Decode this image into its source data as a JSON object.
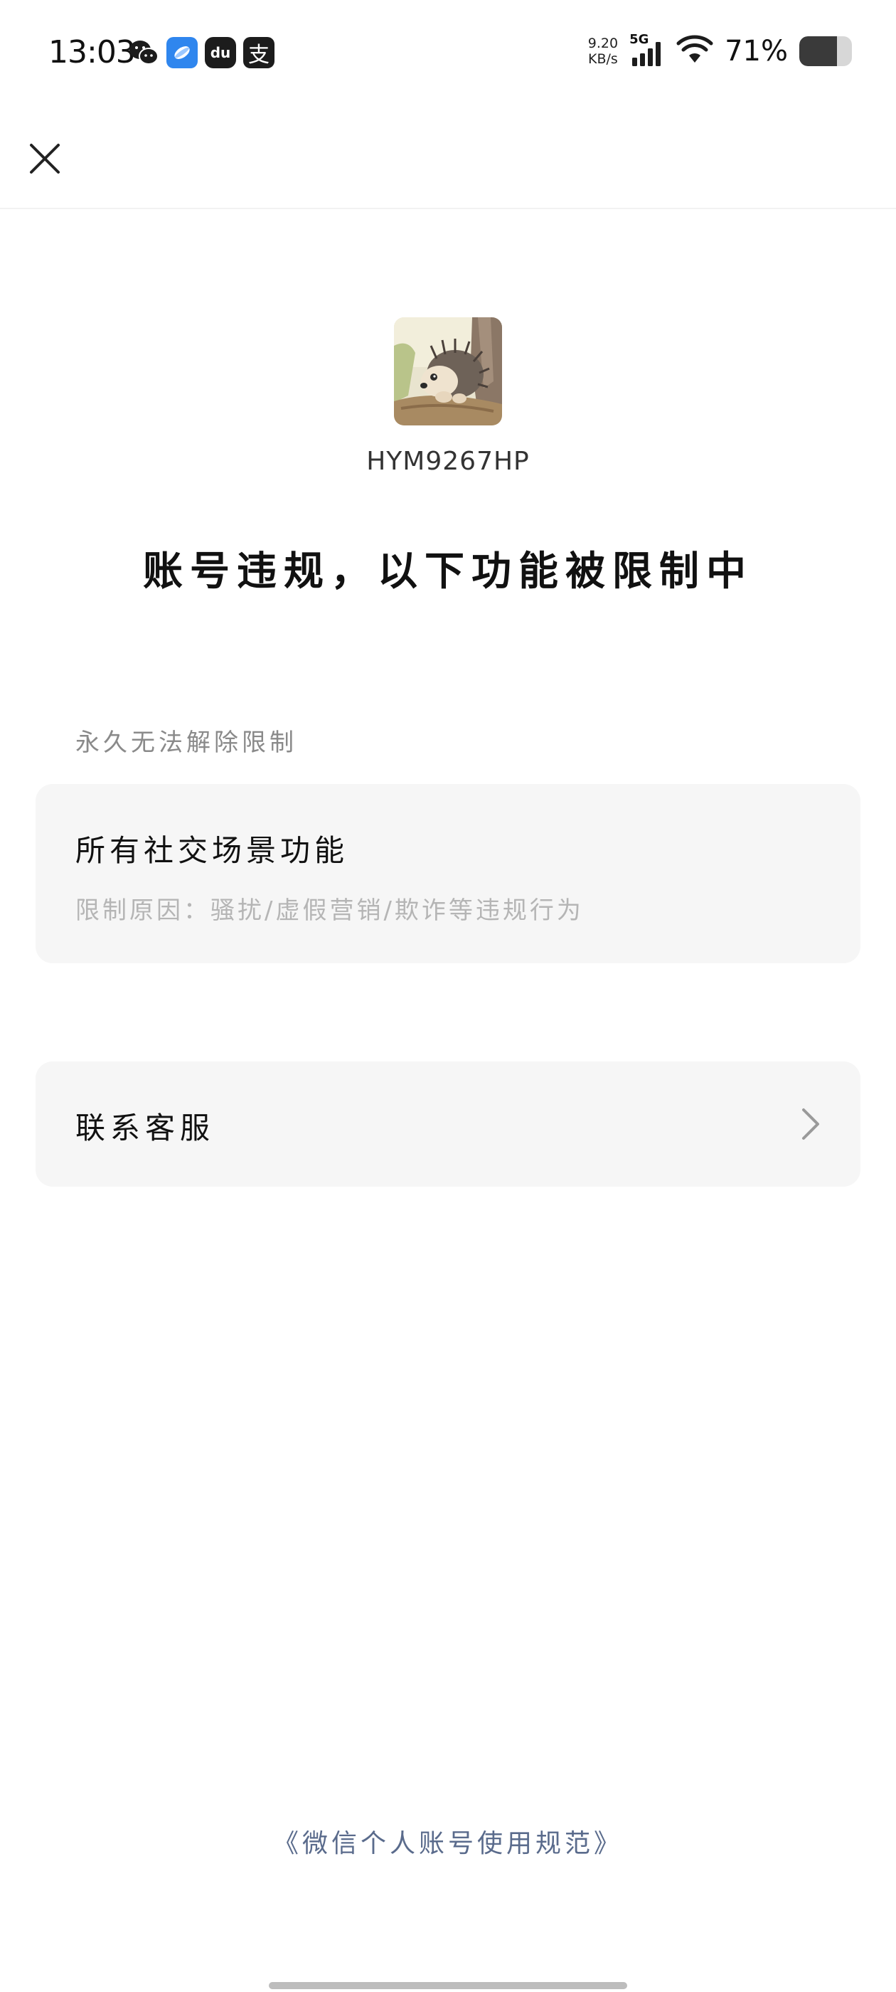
{
  "status_bar": {
    "time": "13:03",
    "net_speed_value": "9.20",
    "net_speed_unit": "KB/s",
    "network": "5G",
    "battery_percent_label": "71%",
    "battery_level": 0.71,
    "app_icons": [
      "wechat-icon",
      "blue-app-icon",
      "du-app-icon",
      "alipay-icon"
    ],
    "du_app_text": "du",
    "pay_app_text": "支"
  },
  "profile": {
    "username": "HYM9267HP"
  },
  "headline": "账号违规，以下功能被限制中",
  "restriction_section": {
    "label": "永久无法解除限制",
    "item_title": "所有社交场景功能",
    "item_reason": "限制原因：骚扰/虚假营销/欺诈等违规行为"
  },
  "contact": {
    "label": "联系客服"
  },
  "footer": {
    "link": "《微信个人账号使用规范》"
  },
  "colors": {
    "card_bg": "#f6f6f6",
    "link": "#5a6b8c",
    "muted": "#8a8a8a"
  }
}
